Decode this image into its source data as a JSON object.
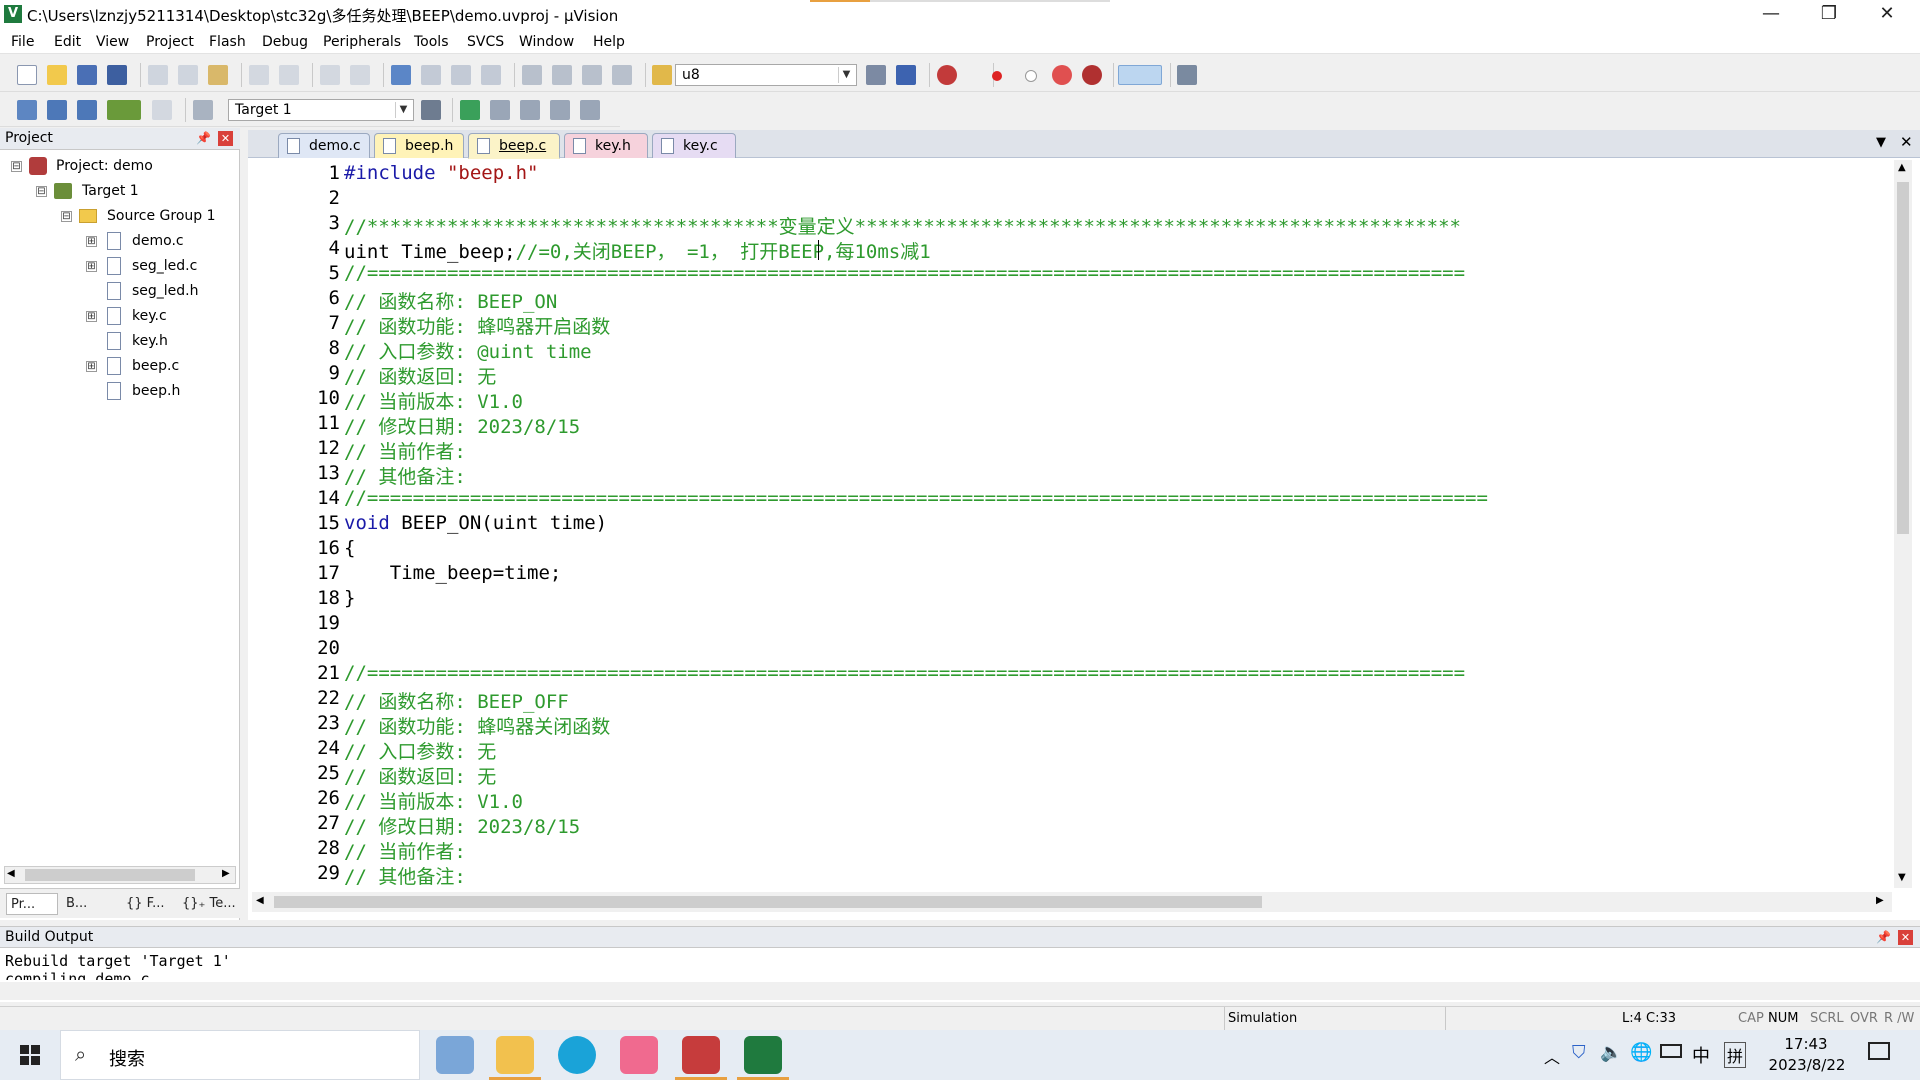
{
  "titlebar": {
    "title": "C:\\Users\\lznzjy5211314\\Desktop\\stc32g\\多任务处理\\BEEP\\demo.uvproj - µVision",
    "minimize": "—",
    "maximize": "❐",
    "close": "✕"
  },
  "menu": [
    "File",
    "Edit",
    "View",
    "Project",
    "Flash",
    "Debug",
    "Peripherals",
    "Tools",
    "SVCS",
    "Window",
    "Help"
  ],
  "toolbar": {
    "find_value": "u8",
    "target_value": "Target 1"
  },
  "project_panel": {
    "title": "Project",
    "tree": [
      {
        "label": "Project: demo",
        "expander": "⊟",
        "icon": "project-icon"
      },
      {
        "label": "Target 1",
        "expander": "⊟",
        "icon": "target-icon"
      },
      {
        "label": "Source Group 1",
        "expander": "⊟",
        "icon": "folder-icon"
      },
      {
        "label": "demo.c",
        "expander": "⊞",
        "icon": "file-icon"
      },
      {
        "label": "seg_led.c",
        "expander": "⊞",
        "icon": "file-icon"
      },
      {
        "label": "seg_led.h",
        "expander": "",
        "icon": "file-icon"
      },
      {
        "label": "key.c",
        "expander": "⊞",
        "icon": "file-icon"
      },
      {
        "label": "key.h",
        "expander": "",
        "icon": "file-icon"
      },
      {
        "label": "beep.c",
        "expander": "⊞",
        "icon": "file-icon"
      },
      {
        "label": "beep.h",
        "expander": "",
        "icon": "file-icon"
      }
    ],
    "tabs": [
      "Pr...",
      "B...",
      "{} F...",
      "{}₊ Te..."
    ]
  },
  "editor_tabs": [
    {
      "label": "demo.c",
      "bg": "#dfe7f5",
      "active": false
    },
    {
      "label": "beep.h",
      "bg": "#fff3b8",
      "active": false
    },
    {
      "label": "beep.c",
      "bg": "#fbf3c8",
      "active": true
    },
    {
      "label": "key.h",
      "bg": "#f6d2dc",
      "active": false
    },
    {
      "label": "key.c",
      "bg": "#e6dcf3",
      "active": false
    }
  ],
  "code_lines": [
    "1",
    "2",
    "3",
    "4",
    "5",
    "6",
    "7",
    "8",
    "9",
    "10",
    "11",
    "12",
    "13",
    "14",
    "15",
    "16",
    "17",
    "18",
    "19",
    "20",
    "21",
    "22",
    "23",
    "24",
    "25",
    "26",
    "27",
    "28",
    "29"
  ],
  "code": {
    "l1a": "#include ",
    "l1b": "\"beep.h\"",
    "l3": "//************************************变量定义*****************************************************",
    "l4a": "uint Time_beep;",
    "l4b": "//=0,关闭BEEP， =1， 打开BEEP,每10ms减1",
    "l5": "//================================================================================================",
    "l6": "// 函数名称: BEEP_ON",
    "l7": "// 函数功能: 蜂鸣器开启函数",
    "l8": "// 入口参数: @uint time",
    "l9": "// 函数返回: 无",
    "l10": "// 当前版本: V1.0",
    "l11": "// 修改日期: 2023/8/15",
    "l12": "// 当前作者:",
    "l13": "// 其他备注:",
    "l14": "//==================================================================================================",
    "l15a": "void",
    "l15b": " BEEP_ON(uint time)",
    "l16": "{",
    "l17": "    Time_beep=time;",
    "l18": "}",
    "l21": "//================================================================================================",
    "l22": "// 函数名称: BEEP_OFF",
    "l23": "// 函数功能: 蜂鸣器关闭函数",
    "l24": "// 入口参数: 无",
    "l25": "// 函数返回: 无",
    "l26": "// 当前版本: V1.0",
    "l27": "// 修改日期: 2023/8/15",
    "l28": "// 当前作者:",
    "l29": "// 其他备注:"
  },
  "build_output": {
    "title": "Build Output",
    "line1": "Rebuild target 'Target 1'",
    "line2": "compiling demo.c..."
  },
  "status": {
    "mode": "Simulation",
    "position": "L:4 C:33",
    "cap": "CAP",
    "num": "NUM",
    "scrl": "SCRL",
    "ovr": "OVR",
    "rw": "R /W"
  },
  "taskbar": {
    "search": "搜索",
    "ime": "中",
    "ime2": "拼",
    "time": "17:43",
    "date": "2023/8/22"
  }
}
